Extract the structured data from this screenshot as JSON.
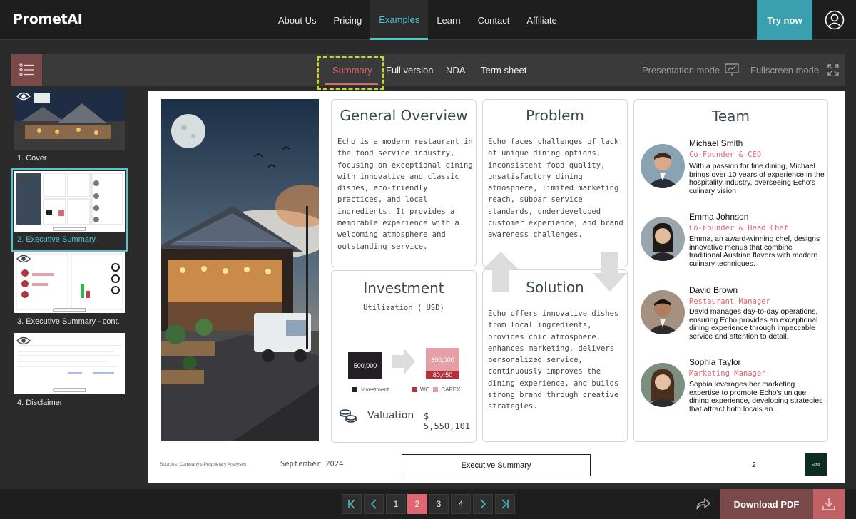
{
  "app": {
    "logo": "PrometAI"
  },
  "nav": {
    "links": [
      "About Us",
      "Pricing",
      "Examples",
      "Learn",
      "Contact",
      "Affiliate"
    ],
    "active": "Examples",
    "try_now": "Try now"
  },
  "toolbar": {
    "tabs": [
      "Summary",
      "Full version",
      "NDA",
      "Term sheet"
    ],
    "active_tab": "Summary",
    "presentation_mode": "Presentation mode",
    "fullscreen_mode": "Fullscreen mode"
  },
  "sidebar": {
    "slides": [
      "1. Cover",
      "2. Executive Summary",
      "3. Executive Summary - cont.",
      "4. Disclaimer"
    ],
    "active_index": 1
  },
  "slide": {
    "overview": {
      "title": "General Overview",
      "text": "Echo is a modern restaurant in the food service industry, focusing on exceptional dining with innovative and classic dishes, eco-friendly practices, and local ingredients. It provides a memorable experience with a welcoming atmosphere and outstanding service."
    },
    "problem": {
      "title": "Problem",
      "text": "Echo faces challenges of lack of unique dining options, inconsistent food quality, unsatisfactory dining atmosphere, limited marketing reach, subpar service standards, underdeveloped customer experience, and brand awareness challenges."
    },
    "solution": {
      "title": "Solution",
      "text": "Echo offers innovative dishes from local ingredients, provides chic atmosphere, enhances marketing, delivers personalized service, continuously improves the dining experience, and builds strong brand through creative strategies."
    },
    "investment": {
      "title": "Investment",
      "subtitle": "Utilization ( USD)",
      "investment_value": "500,000",
      "wc_value": "500,000",
      "capex_value": "80,450",
      "legend_investment": "Investment",
      "legend_wc": "WC",
      "legend_capex": "CAPEX",
      "valuation_label": "Valuation",
      "valuation_value": "$ 5,550,101"
    },
    "team": {
      "title": "Team",
      "members": [
        {
          "name": "Michael Smith",
          "role": "Co-Founder & CEO",
          "bio": "With a passion for fine dining, Michael brings over 10 years of experience in the hospitality industry, overseeing Echo's culinary vision"
        },
        {
          "name": "Emma Johnson",
          "role": "Co-Founder & Head Chef",
          "bio": "Emma, an award-winning chef, designs innovative menus that combine traditional Austrian flavors with modern culinary techniques."
        },
        {
          "name": "David Brown",
          "role": "Restaurant Manager",
          "bio": "David manages day-to-day operations, ensuring Echo provides an exceptional dining experience through impeccable service and attention to detail."
        },
        {
          "name": "Sophia Taylor",
          "role": "Marketing Manager",
          "bio": "Sophia leverages her marketing expertise to promote Echo's unique dining experience, developing strategies that attract both locals an..."
        }
      ]
    },
    "footer": {
      "sources": "Sources: Company's Proprietary Analyses",
      "date": "September 2024",
      "section": "Executive Summary",
      "page": "2",
      "logo_text": "Echo"
    }
  },
  "pagination": {
    "pages": [
      "1",
      "2",
      "3",
      "4"
    ],
    "active": "2"
  },
  "download": {
    "label": "Download PDF"
  },
  "colors": {
    "accent": "#4ec6d4",
    "brand_red": "#e06670",
    "download_bg": "#7a4a4a"
  }
}
